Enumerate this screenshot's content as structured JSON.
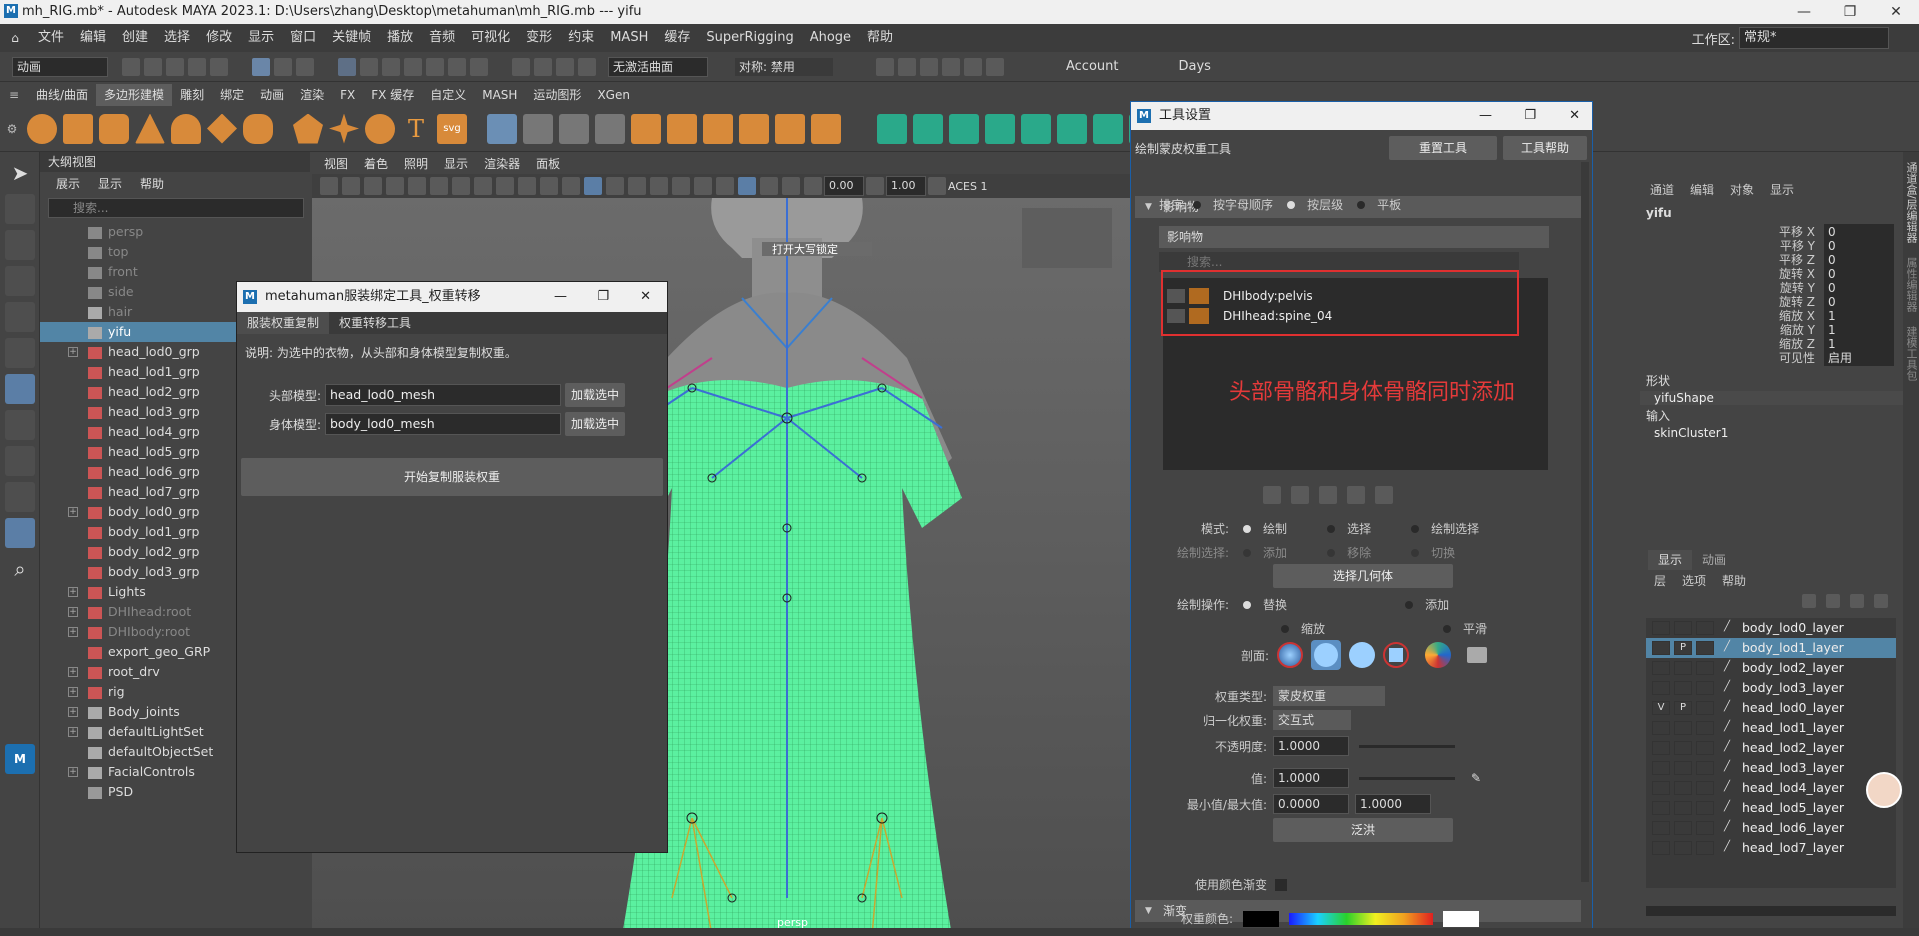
{
  "window": {
    "title": "mh_RIG.mb* - Autodesk MAYA 2023.1: D:\\Users\\zhang\\Desktop\\metahuman\\mh_RIG.mb   ---   yifu",
    "logo": "M",
    "minimize": "—",
    "maximize": "❐",
    "close": "✕"
  },
  "menubar": {
    "items": [
      "文件",
      "编辑",
      "创建",
      "选择",
      "修改",
      "显示",
      "窗口",
      "关键帧",
      "播放",
      "音频",
      "可视化",
      "变形",
      "约束",
      "MASH",
      "缓存",
      "SuperRigging",
      "Ahoge",
      "帮助"
    ],
    "workspace_label": "工作区:",
    "workspace_value": "常规*"
  },
  "statusline": {
    "mode": "动画",
    "live_surface": "无激活曲面",
    "symmetry": "对称: 禁用",
    "account": "Account",
    "days": "Days"
  },
  "shelf": {
    "tabs": [
      "曲线/曲面",
      "多边形建模",
      "雕刻",
      "绑定",
      "动画",
      "渲染",
      "FX",
      "FX 缓存",
      "自定义",
      "MASH",
      "运动图形",
      "XGen"
    ],
    "active_tab": 1
  },
  "outliner": {
    "title": "大纲视图",
    "menu": [
      "展示",
      "显示",
      "帮助"
    ],
    "search_placeholder": "搜索...",
    "rows": [
      {
        "label": "persp",
        "dim": true,
        "icon": "camera-icon"
      },
      {
        "label": "top",
        "dim": true,
        "icon": "camera-icon"
      },
      {
        "label": "front",
        "dim": true,
        "icon": "camera-icon"
      },
      {
        "label": "side",
        "dim": true,
        "icon": "camera-icon"
      },
      {
        "label": "hair",
        "dim": true,
        "icon": "mesh-icon"
      },
      {
        "label": "yifu",
        "sel": true,
        "icon": "mesh-icon"
      },
      {
        "label": "head_lod0_grp",
        "exp": "+",
        "icon": "group-icon"
      },
      {
        "label": "head_lod1_grp",
        "icon": "group-icon"
      },
      {
        "label": "head_lod2_grp",
        "icon": "group-icon"
      },
      {
        "label": "head_lod3_grp",
        "icon": "group-icon"
      },
      {
        "label": "head_lod4_grp",
        "icon": "group-icon"
      },
      {
        "label": "head_lod5_grp",
        "icon": "group-icon"
      },
      {
        "label": "head_lod6_grp",
        "icon": "group-icon"
      },
      {
        "label": "head_lod7_grp",
        "icon": "group-icon"
      },
      {
        "label": "body_lod0_grp",
        "exp": "+",
        "icon": "group-icon"
      },
      {
        "label": "body_lod1_grp",
        "icon": "group-icon"
      },
      {
        "label": "body_lod2_grp",
        "icon": "group-icon"
      },
      {
        "label": "body_lod3_grp",
        "icon": "group-icon"
      },
      {
        "label": "Lights",
        "exp": "+",
        "icon": "group-icon"
      },
      {
        "label": "DHIhead:root",
        "exp": "+",
        "dim": true,
        "icon": "joint-icon"
      },
      {
        "label": "DHIbody:root",
        "exp": "+",
        "dim": true,
        "icon": "joint-icon"
      },
      {
        "label": "export_geo_GRP",
        "icon": "group-icon"
      },
      {
        "label": "root_drv",
        "exp": "+",
        "icon": "joint-icon"
      },
      {
        "label": "rig",
        "exp": "+",
        "icon": "group-icon"
      },
      {
        "label": "Body_joints",
        "exp": "+",
        "icon": "set-icon"
      },
      {
        "label": "defaultLightSet",
        "exp": "+",
        "icon": "set-icon"
      },
      {
        "label": "defaultObjectSet",
        "icon": "set-icon"
      },
      {
        "label": "FacialControls",
        "exp": "+",
        "icon": "set-icon"
      },
      {
        "label": "PSD",
        "icon": "psd-icon"
      }
    ]
  },
  "viewport": {
    "menu": [
      "视图",
      "着色",
      "照明",
      "显示",
      "渲染器",
      "面板"
    ],
    "field1": "0.00",
    "field2": "1.00",
    "colorspace": "ACES 1",
    "caps_lock_text": "打开大写锁定",
    "camera_label": "persp"
  },
  "mhdialog": {
    "title": "metahuman服装绑定工具_权重转移",
    "tabs": [
      "服装权重复制",
      "权重转移工具"
    ],
    "description": "说明: 为选中的衣物，从头部和身体模型复制权重。",
    "head_label": "头部模型:",
    "head_value": "head_lod0_mesh",
    "body_label": "身体模型:",
    "body_value": "body_lod0_mesh",
    "load_btn": "加载选中",
    "start_btn": "开始复制服装权重"
  },
  "toolsettings": {
    "title": "工具设置",
    "tool_name": "绘制蒙皮权重工具",
    "reset_btn": "重置工具",
    "help_btn": "工具帮助",
    "section_influence": "影响物",
    "sort_label": "排序:",
    "sort_options": [
      "按字母顺序",
      "按层级",
      "平板"
    ],
    "influence_header": "影响物",
    "search_placeholder": "搜索...",
    "influences": [
      "DHIbody:pelvis",
      "DHIhead:spine_04"
    ],
    "annotation": "头部骨骼和身体骨骼同时添加",
    "mode_label": "模式:",
    "mode_options": [
      "绘制",
      "选择",
      "绘制选择"
    ],
    "paint_select_label": "绘制选择:",
    "paint_select_options": [
      "添加",
      "移除",
      "切换"
    ],
    "select_geo_btn": "选择几何体",
    "paint_op_label": "绘制操作:",
    "paint_op_options": [
      "替换",
      "添加",
      "缩放",
      "平滑"
    ],
    "profile_label": "剖面:",
    "weight_type_label": "权重类型:",
    "weight_type_value": "蒙皮权重",
    "normalize_label": "归一化权重:",
    "normalize_value": "交互式",
    "opacity_label": "不透明度:",
    "opacity_value": "1.0000",
    "value_label": "值:",
    "value_value": "1.0000",
    "minmax_label": "最小值/最大值:",
    "min_value": "0.0000",
    "max_value": "1.0000",
    "flood_btn": "泛洪",
    "section_gradient": "渐变",
    "use_color_ramp": "使用颜色渐变",
    "weight_color_label": "权重颜色:"
  },
  "channelbox": {
    "menu": [
      "通道",
      "编辑",
      "对象",
      "显示"
    ],
    "object": "yifu",
    "attrs": [
      {
        "name": "平移 X",
        "value": "0"
      },
      {
        "name": "平移 Y",
        "value": "0"
      },
      {
        "name": "平移 Z",
        "value": "0"
      },
      {
        "name": "旋转 X",
        "value": "0"
      },
      {
        "name": "旋转 Y",
        "value": "0"
      },
      {
        "name": "旋转 Z",
        "value": "0"
      },
      {
        "name": "缩放 X",
        "value": "1"
      },
      {
        "name": "缩放 Y",
        "value": "1"
      },
      {
        "name": "缩放 Z",
        "value": "1"
      },
      {
        "name": "可见性",
        "value": "启用"
      }
    ],
    "shapes_label": "形状",
    "shape_name": "yifuShape",
    "inputs_label": "输入",
    "input_name": "skinCluster1",
    "layer_tabs": [
      "显示",
      "动画"
    ],
    "layer_menu": [
      "层",
      "选项",
      "帮助"
    ],
    "layers": [
      {
        "name": "body_lod0_layer",
        "v": "",
        "p": ""
      },
      {
        "name": "body_lod1_layer",
        "v": "",
        "p": "P",
        "sel": true
      },
      {
        "name": "body_lod2_layer",
        "v": "",
        "p": ""
      },
      {
        "name": "body_lod3_layer",
        "v": "",
        "p": ""
      },
      {
        "name": "head_lod0_layer",
        "v": "V",
        "p": "P"
      },
      {
        "name": "head_lod1_layer",
        "v": "",
        "p": ""
      },
      {
        "name": "head_lod2_layer",
        "v": "",
        "p": ""
      },
      {
        "name": "head_lod3_layer",
        "v": "",
        "p": ""
      },
      {
        "name": "head_lod4_layer",
        "v": "",
        "p": ""
      },
      {
        "name": "head_lod5_layer",
        "v": "",
        "p": ""
      },
      {
        "name": "head_lod6_layer",
        "v": "",
        "p": ""
      },
      {
        "name": "head_lod7_layer",
        "v": "",
        "p": ""
      }
    ],
    "side_tabs": [
      "通道盒/层编辑器",
      "属性编辑器",
      "建模工具包"
    ]
  }
}
